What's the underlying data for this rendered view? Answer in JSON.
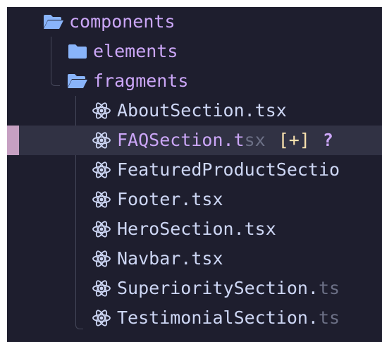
{
  "colors": {
    "background": "#1e1e2e",
    "folder": "#89b4fa",
    "folder_text": "#cba6f7",
    "file_text": "#cdd6f4",
    "react_icon": "#cdd6f4",
    "selected_row": "#313244",
    "selection_marker": "#c6a0c2",
    "modified_badge": "#f9e2af",
    "untracked": "#cba6f7",
    "tree_guide": "#45475a"
  },
  "tree": {
    "root": {
      "name": "components",
      "icon": "folder-open-icon"
    },
    "folders": [
      {
        "name": "elements",
        "icon": "folder-closed-icon",
        "expanded": false
      },
      {
        "name": "fragments",
        "icon": "folder-open-icon",
        "expanded": true
      }
    ],
    "files": [
      {
        "name_main": "AboutSection.tsx",
        "name_faded": "",
        "icon": "react-icon"
      },
      {
        "name_main": "FAQSection.t",
        "name_faded": "sx",
        "icon": "react-icon",
        "selected": true,
        "badge": "[+]",
        "status": "?"
      },
      {
        "name_main": "FeaturedProductSectio",
        "name_faded": "",
        "icon": "react-icon"
      },
      {
        "name_main": "Footer.tsx",
        "name_faded": "",
        "icon": "react-icon"
      },
      {
        "name_main": "HeroSection.tsx",
        "name_faded": "",
        "icon": "react-icon"
      },
      {
        "name_main": "Navbar.tsx",
        "name_faded": "",
        "icon": "react-icon"
      },
      {
        "name_main": "SuperioritySection.",
        "name_faded": "ts",
        "icon": "react-icon"
      },
      {
        "name_main": "TestimonialSection.",
        "name_faded": "ts",
        "icon": "react-icon"
      }
    ]
  }
}
